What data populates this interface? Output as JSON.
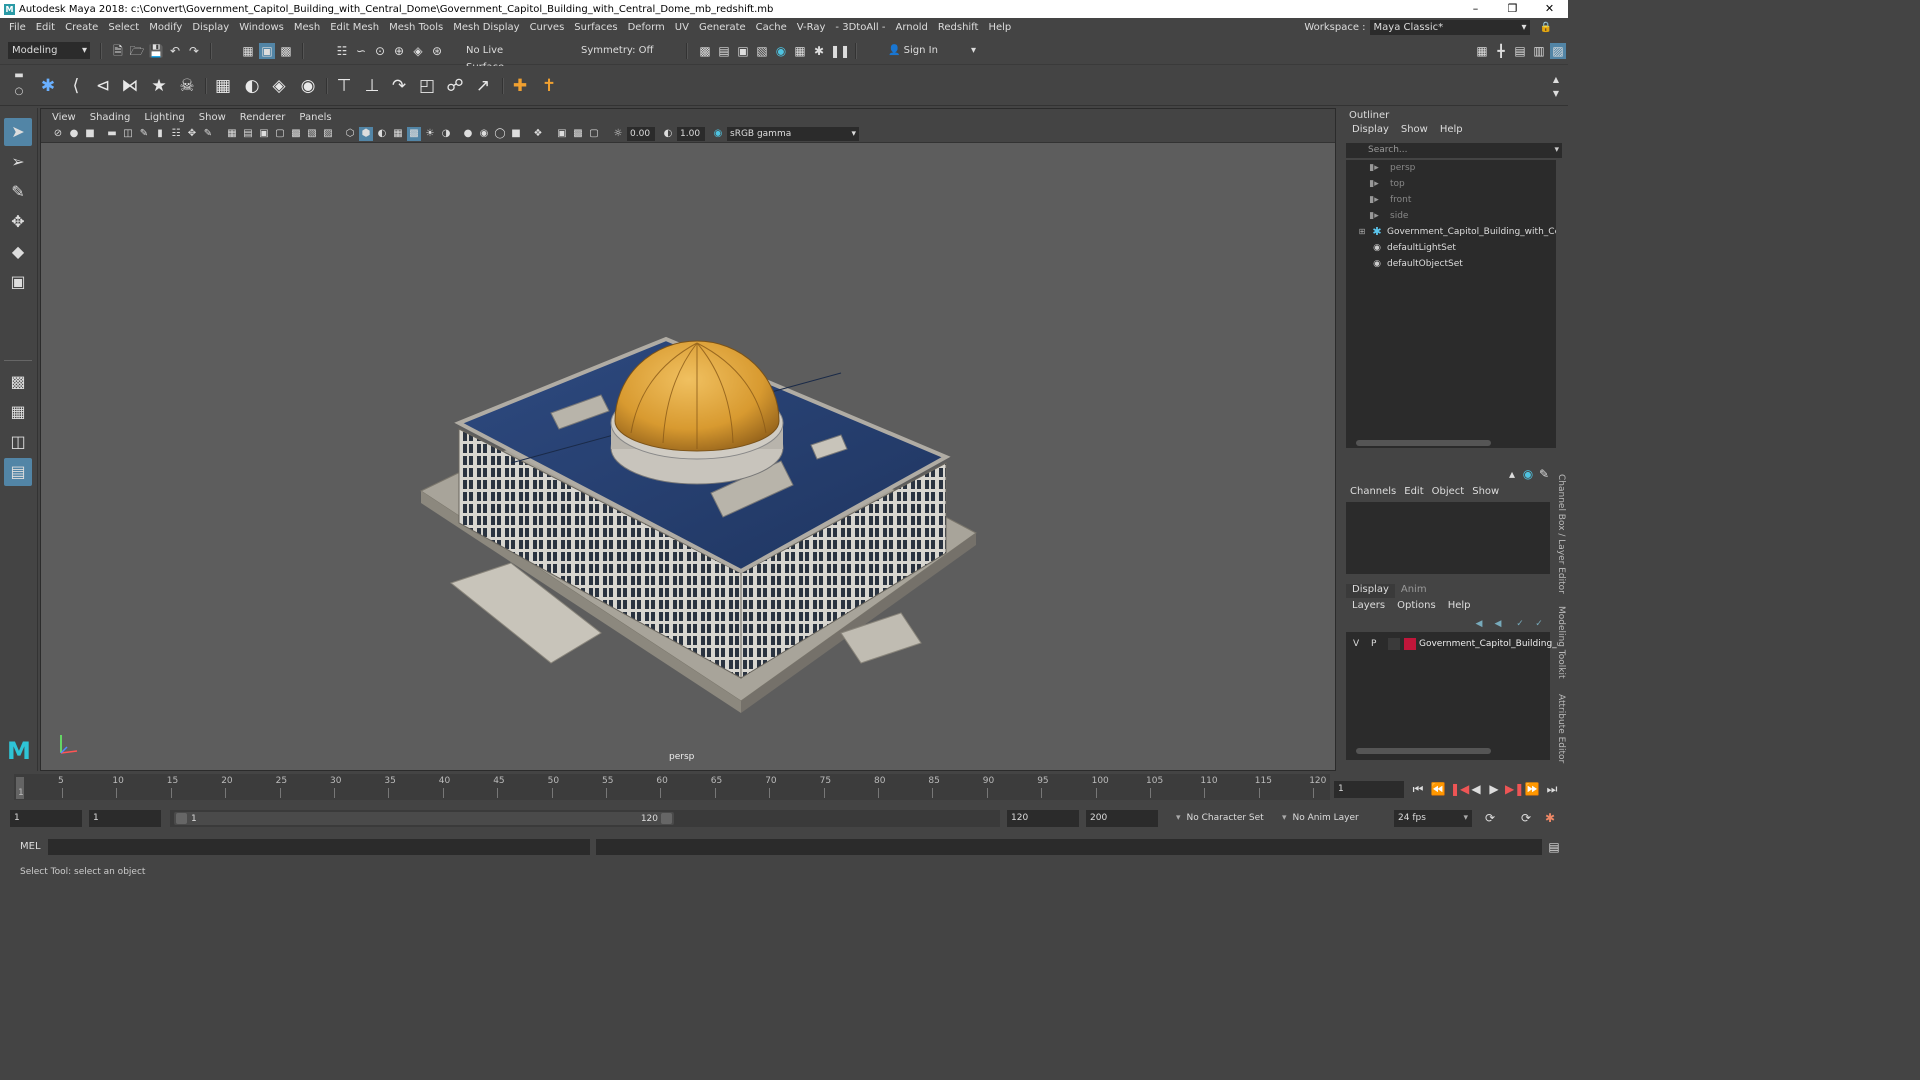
{
  "window": {
    "title": "Autodesk Maya 2018: c:\\Convert\\Government_Capitol_Building_with_Central_Dome\\Government_Capitol_Building_with_Central_Dome_mb_redshift.mb"
  },
  "menubar": {
    "items": [
      "File",
      "Edit",
      "Create",
      "Select",
      "Modify",
      "Display",
      "Windows",
      "Mesh",
      "Edit Mesh",
      "Mesh Tools",
      "Mesh Display",
      "Curves",
      "Surfaces",
      "Deform",
      "UV",
      "Generate",
      "Cache",
      "V-Ray",
      "- 3DtoAll -",
      "Arnold",
      "Redshift",
      "Help"
    ]
  },
  "workspace": {
    "label": "Workspace :",
    "value": "Maya Classic*"
  },
  "statusline": {
    "mode": "Modeling",
    "live_surface": "No Live Surface",
    "symmetry": "Symmetry: Off",
    "sign_in": "Sign In"
  },
  "viewport": {
    "menu": [
      "View",
      "Shading",
      "Lighting",
      "Show",
      "Renderer",
      "Panels"
    ],
    "exposure": "0.00",
    "gamma": "1.00",
    "color_space": "sRGB gamma",
    "camera": "persp"
  },
  "outliner": {
    "title": "Outliner",
    "menu": [
      "Display",
      "Show",
      "Help"
    ],
    "search_placeholder": "Search...",
    "items": [
      {
        "label": "persp",
        "icon": "camera-icon"
      },
      {
        "label": "top",
        "icon": "camera-icon"
      },
      {
        "label": "front",
        "icon": "camera-icon"
      },
      {
        "label": "side",
        "icon": "camera-icon"
      },
      {
        "label": "Government_Capitol_Building_with_Cer",
        "icon": "group-icon"
      },
      {
        "label": "defaultLightSet",
        "icon": "set-icon"
      },
      {
        "label": "defaultObjectSet",
        "icon": "set-icon"
      }
    ]
  },
  "channelbox": {
    "menu": [
      "Channels",
      "Edit",
      "Object",
      "Show"
    ]
  },
  "layer_editor": {
    "tabs": [
      "Display",
      "Anim"
    ],
    "menu": [
      "Layers",
      "Options",
      "Help"
    ],
    "layer": {
      "v": "V",
      "p": "P",
      "name": "Government_Capitol_Building_",
      "color": "#c0163a"
    }
  },
  "side_tabs": [
    "Channel Box / Layer Editor",
    "Modeling Toolkit",
    "Attribute Editor"
  ],
  "timeline": {
    "ticks": [
      "5",
      "10",
      "15",
      "20",
      "25",
      "30",
      "35",
      "40",
      "45",
      "50",
      "55",
      "60",
      "65",
      "70",
      "75",
      "80",
      "85",
      "90",
      "95",
      "100",
      "105",
      "110",
      "115",
      "120"
    ],
    "start_label": "1",
    "current_frame": "1"
  },
  "range": {
    "start": "1",
    "anim_start": "1",
    "slider_start": "1",
    "slider_end": "120",
    "end": "120",
    "anim_end": "200",
    "character_set": "No Character Set",
    "anim_layer": "No Anim Layer",
    "fps": "24 fps"
  },
  "cmdline": {
    "label": "MEL"
  },
  "helpline": {
    "text": "Select Tool: select an object"
  }
}
